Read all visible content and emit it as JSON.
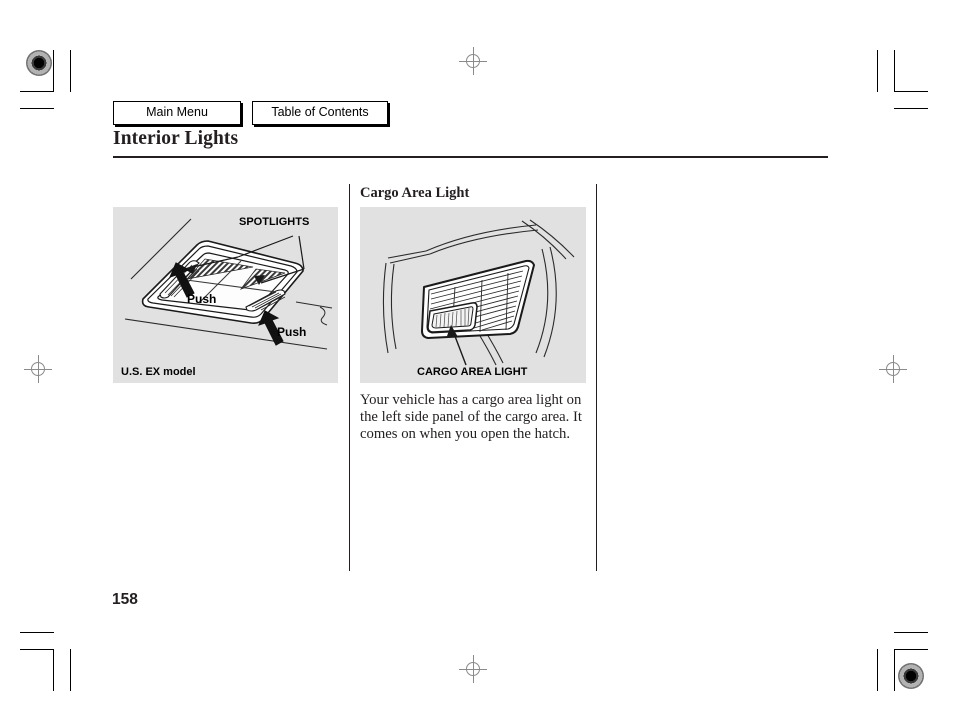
{
  "document": {
    "page_number": "158",
    "page_title": "Interior Lights"
  },
  "nav": {
    "main_menu_label": "Main Menu",
    "table_of_contents_label": "Table of Contents"
  },
  "left_column": {
    "figure": {
      "caption": "U.S. EX model",
      "callouts": [
        {
          "label": "SPOTLIGHTS"
        },
        {
          "label": "Push"
        },
        {
          "label": "Push"
        }
      ]
    }
  },
  "right_column": {
    "section_heading": "Cargo Area Light",
    "figure": {
      "caption": "CARGO AREA LIGHT"
    },
    "body_text": "Your vehicle has a cargo area light on the left side panel of the cargo area. It comes on when you open the hatch."
  },
  "colors": {
    "figure_background": "#e1e1e1",
    "text": "#231f20",
    "rule": "#231f20",
    "registration_mark": "#8a8a8a"
  }
}
